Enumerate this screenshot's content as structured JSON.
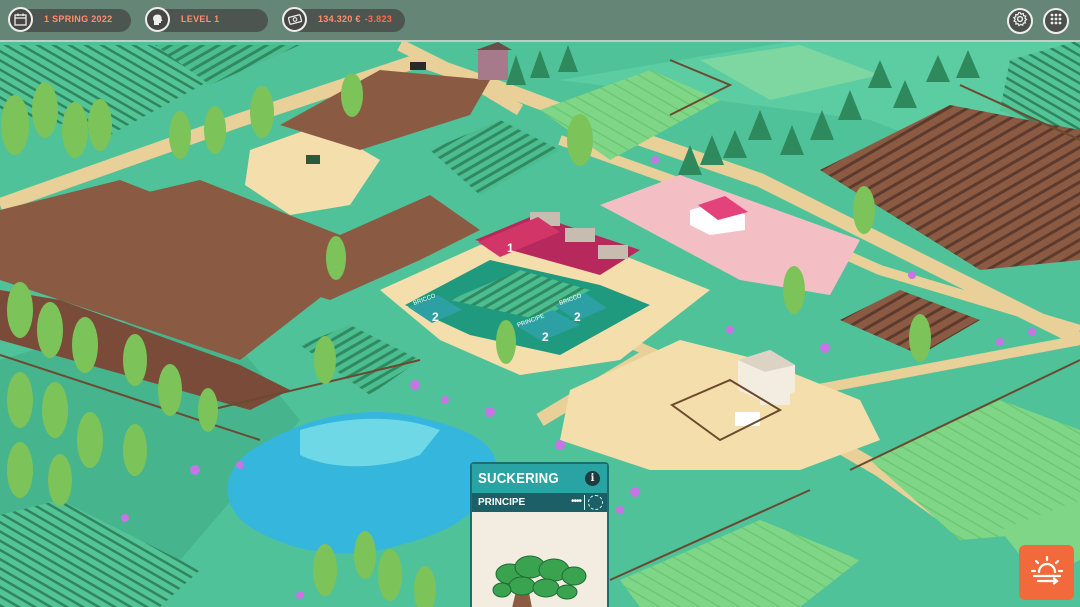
{
  "hud": {
    "date": "1 SPRING 2022",
    "level": "LEVEL 1",
    "money": "134.320 €",
    "money_change": "-3.823",
    "icons": {
      "date": "calendar-icon",
      "level": "head-profile-icon",
      "money": "money-bill-icon",
      "settings": "gear-icon",
      "menu": "grid-menu-icon"
    }
  },
  "plots": [
    {
      "name": "1"
    },
    {
      "name": "BRICCO",
      "number": "2"
    },
    {
      "name": "PRINCIPE",
      "number": "2"
    },
    {
      "name": "BRICCO",
      "number": "2"
    }
  ],
  "task_card": {
    "title": "SUCKERING",
    "info": "i",
    "plot": "PRINCIPE",
    "dots": "••••"
  },
  "actions": {
    "end_turn_icon": "sunrise-icon"
  },
  "colors": {
    "accent": "#f26a3c",
    "card_header": "#2aa3a5",
    "card_sub": "#1c5f66",
    "grass": "#4fc29a",
    "water": "#35b6dd"
  }
}
